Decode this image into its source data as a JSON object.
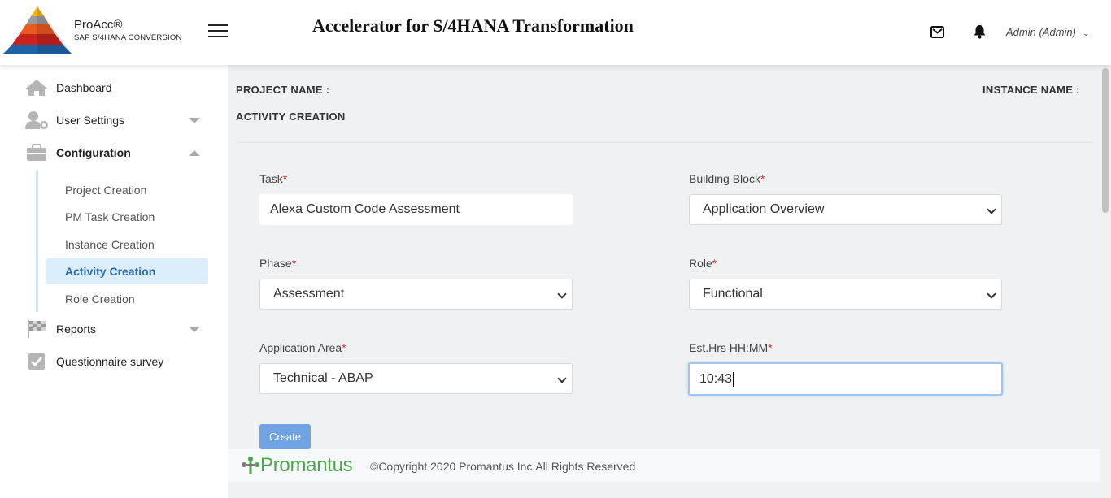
{
  "header": {
    "brand_name": "ProAcc®",
    "brand_sub": "SAP S/4HANA CONVERSION",
    "title": "Accelerator for S/4HANA Transformation",
    "user": "Admin (Admin)"
  },
  "sidebar": {
    "items": [
      {
        "label": "Dashboard"
      },
      {
        "label": "User Settings"
      },
      {
        "label": "Configuration"
      },
      {
        "label": "Reports"
      },
      {
        "label": "Questionnaire survey"
      }
    ],
    "config_sub": [
      {
        "label": "Project Creation"
      },
      {
        "label": "PM Task Creation"
      },
      {
        "label": "Instance Creation"
      },
      {
        "label": "Activity Creation"
      },
      {
        "label": "Role Creation"
      }
    ]
  },
  "main": {
    "project_name_label": "PROJECT NAME :",
    "instance_name_label": "INSTANCE NAME :",
    "section_title": "ACTIVITY CREATION",
    "fields": {
      "task": {
        "label": "Task",
        "value": "Alexa Custom Code Assessment"
      },
      "building_block": {
        "label": "Building Block",
        "value": "Application Overview"
      },
      "phase": {
        "label": "Phase",
        "value": "Assessment"
      },
      "role": {
        "label": "Role",
        "value": "Functional"
      },
      "application_area": {
        "label": "Application Area",
        "value": "Technical - ABAP"
      },
      "est_hrs": {
        "label": "Est.Hrs HH:MM",
        "value": "10:43"
      }
    },
    "required_mark": "*",
    "create_label": "Create"
  },
  "footer": {
    "logo_text": "Promantus",
    "copyright": "©Copyright 2020 Promantus Inc,All Rights Reserved"
  },
  "colors": {
    "accent": "#2a6ab5",
    "active_bg": "#dcedfb",
    "button": "#6fa3e3",
    "required": "#d9302c",
    "footer_logo": "#49a84a"
  }
}
